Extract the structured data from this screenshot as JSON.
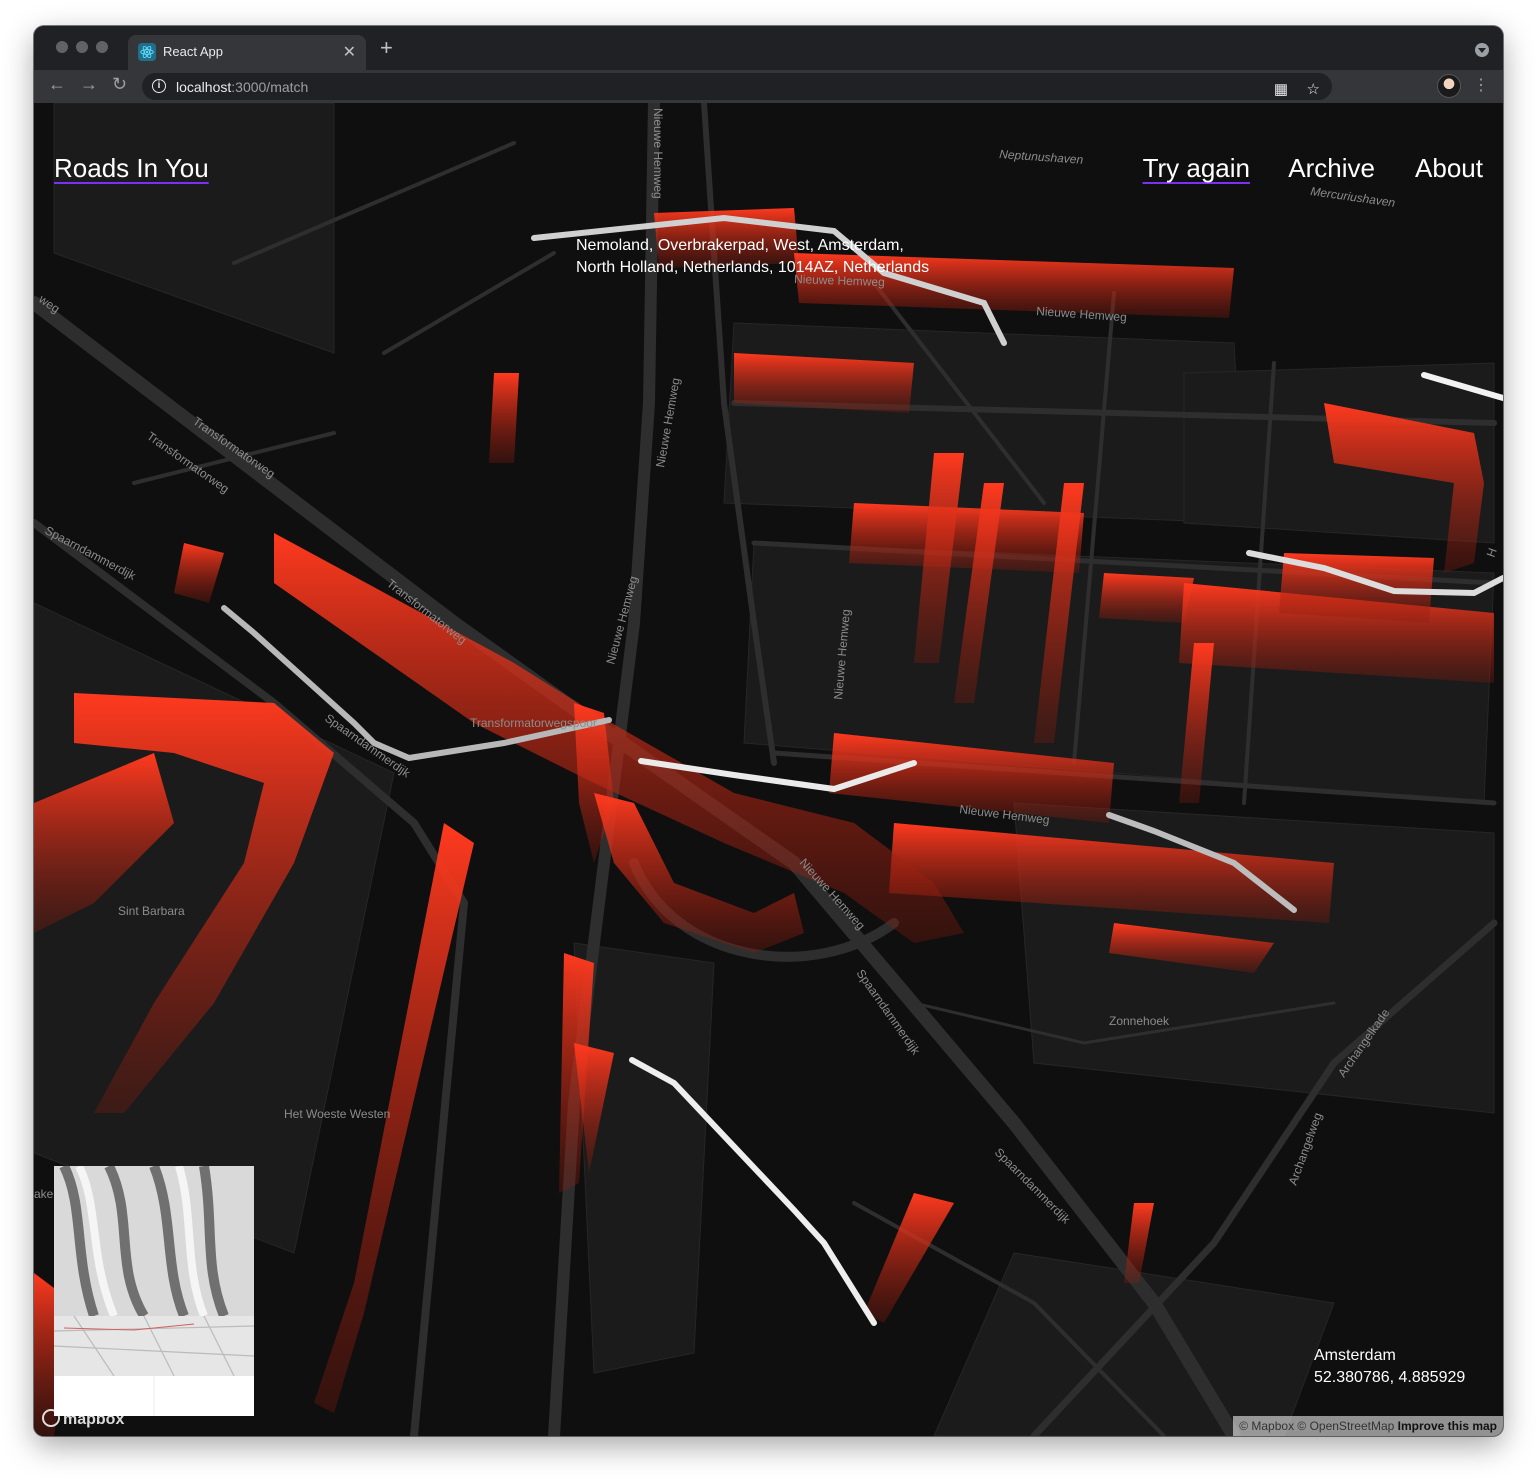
{
  "browser": {
    "tab_title": "React App",
    "tab_close": "✕",
    "new_tab": "+",
    "url_host": "localhost",
    "url_path": ":3000/match"
  },
  "app": {
    "brand": "Roads In You",
    "nav": [
      "Try again",
      "Archive",
      "About"
    ],
    "address_line1": "Nemoland, Overbrakerpad, West, Amsterdam,",
    "address_line2": "North Holland, Netherlands, 1014AZ, Netherlands",
    "city": "Amsterdam",
    "coords": "52.380786, 4.885929"
  },
  "map": {
    "labels": {
      "neptunushaven": "Neptunushaven",
      "mercuriushaven": "Mercuriushaven",
      "nieuwe_hemweg": "Nieuwe Hemweg",
      "transformatorweg": "Transformatorweg",
      "spaarndammerdijk": "Spaarndammerdijk",
      "transformatorwegspoor": "Transformatorwegspoor",
      "sint_barbara": "Sint Barbara",
      "het_woeste_westen": "Het Woeste Westen",
      "zonnehoek": "Zonnehoek",
      "archangelkade": "Archangelkade",
      "archangelweg": "Archangelweg",
      "weg_fragment": "weg",
      "akeweg_fragment": "ake",
      "ha_fragment": "H"
    },
    "logo": "mapbox",
    "attribution": "© Mapbox © OpenStreetMap",
    "improve": "Improve this map"
  },
  "colors": {
    "accent_red": "#e0301c",
    "background": "#0f0f0f",
    "road": "#2e2e2e",
    "underline": "#7b2ff7"
  }
}
